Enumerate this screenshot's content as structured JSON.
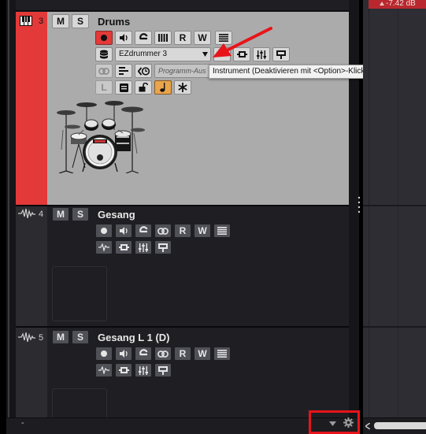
{
  "tracks": [
    {
      "number": "3",
      "name": "Drums",
      "mute_label": "M",
      "solo_label": "S",
      "read_label": "R",
      "write_label": "W",
      "instrument": "EZdrummer 3",
      "program_placeholder": "Programm-Aus",
      "lane_label": "L"
    },
    {
      "number": "4",
      "name": "Gesang",
      "mute_label": "M",
      "solo_label": "S",
      "read_label": "R",
      "write_label": "W"
    },
    {
      "number": "5",
      "name": "Gesang L 1 (D)",
      "mute_label": "M",
      "solo_label": "S",
      "read_label": "R",
      "write_label": "W"
    }
  ],
  "tooltip": "Instrument (Deaktivieren mit <Option>-Klick)",
  "meter_readout": "-7.42 dB",
  "footer_left": "-",
  "colors": {
    "drums_track": "#e33939",
    "selected_panel": "#ababab",
    "track_panel": "#1f1f23",
    "annotation": "#e8141a"
  }
}
